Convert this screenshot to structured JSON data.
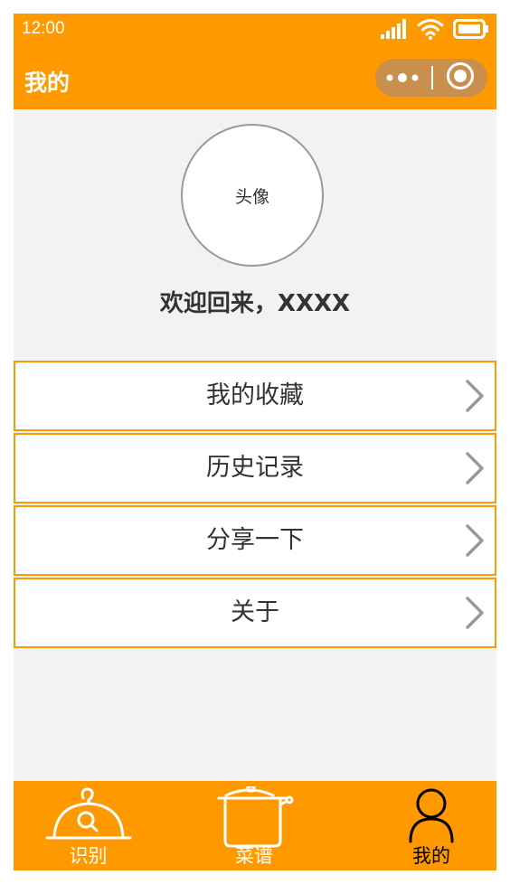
{
  "status_bar": {
    "time": "12:00",
    "icons": [
      "signal-icon",
      "wifi-icon",
      "battery-icon"
    ]
  },
  "nav_bar": {
    "title": "我的",
    "capsule_icons": [
      "more-dots-icon",
      "close-circle-icon"
    ]
  },
  "profile": {
    "avatar_placeholder": "头像",
    "welcome_text": "欢迎回来，XXXX"
  },
  "menu": {
    "items": [
      {
        "label": "我的收藏",
        "icon": "chevron-right-icon"
      },
      {
        "label": "历史记录",
        "icon": "chevron-right-icon"
      },
      {
        "label": "分享一下",
        "icon": "chevron-right-icon"
      },
      {
        "label": "关于",
        "icon": "chevron-right-icon"
      }
    ]
  },
  "tab_bar": {
    "tabs": [
      {
        "label": "识别",
        "icon": "cloche-search-icon",
        "active": false
      },
      {
        "label": "菜谱",
        "icon": "pot-icon",
        "active": false
      },
      {
        "label": "我的",
        "icon": "user-icon",
        "active": true
      }
    ]
  },
  "colors": {
    "brand": "#ff9900",
    "page_background": "#f2f2f2",
    "capsule": "#c98f4d",
    "text": "#333333",
    "tab_inactive": "#ffffff",
    "tab_active": "#000000"
  }
}
